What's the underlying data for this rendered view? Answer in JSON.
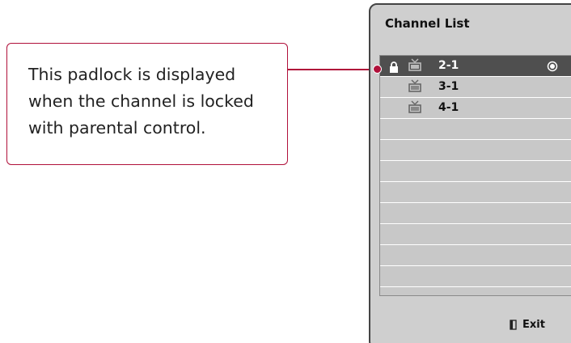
{
  "callout": {
    "text": "This padlock is displayed when the channel is locked with parental control."
  },
  "panel": {
    "title": "Channel List",
    "exit_label": "Exit"
  },
  "channels": [
    {
      "number": "2-1",
      "locked": true,
      "selected": true
    },
    {
      "number": "3-1",
      "locked": false,
      "selected": false
    },
    {
      "number": "4-1",
      "locked": false,
      "selected": false
    }
  ],
  "colors": {
    "accent": "#b0103a",
    "panel_bg": "#cfcfcf",
    "selected_row": "#4f4f4f"
  },
  "icons": {
    "lock": "padlock-icon",
    "tv": "tv-icon",
    "radio": "radio-selected-icon",
    "exit": "exit-door-icon"
  }
}
